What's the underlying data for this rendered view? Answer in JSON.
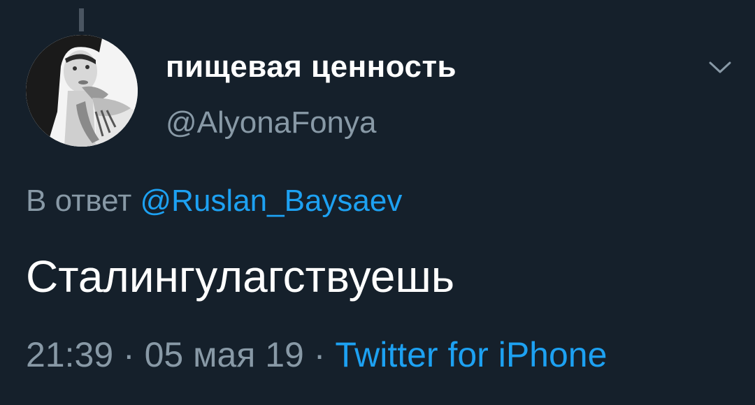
{
  "tweet": {
    "display_name": "пищевая ценность",
    "handle": "@AlyonaFonya",
    "reply_prefix": "В ответ",
    "reply_mention": "@Ruslan_Baysaev",
    "text": "Сталингулагствуешь",
    "time": "21:39",
    "separator": "·",
    "date": "05 мая 19",
    "source": "Twitter for iPhone"
  },
  "icons": {
    "menu": "chevron-down-icon"
  },
  "colors": {
    "background": "#15202b",
    "text_primary": "#ffffff",
    "text_secondary": "#8899a6",
    "link": "#1da1f2"
  }
}
